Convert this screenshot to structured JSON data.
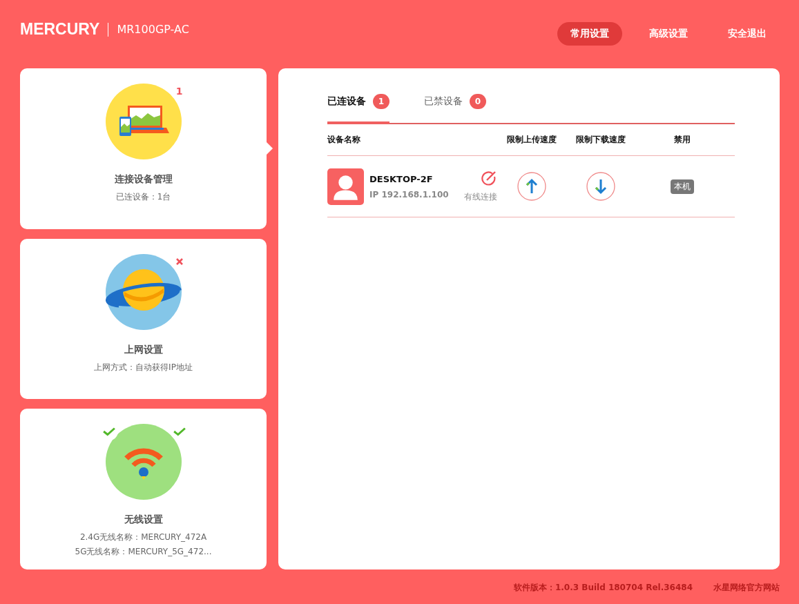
{
  "header": {
    "brand": "MERCURY",
    "model": "MR100GP-AC"
  },
  "nav": [
    {
      "label": "常用设置",
      "selected": true
    },
    {
      "label": "高级设置",
      "selected": false
    },
    {
      "label": "安全退出",
      "selected": false
    }
  ],
  "cards": [
    {
      "kind": "devices",
      "title": "连接设备管理",
      "selected": true,
      "badges": [
        {
          "kind": "count",
          "text": "1"
        }
      ],
      "lines": [
        "已连设备：1台"
      ]
    },
    {
      "kind": "internet",
      "title": "上网设置",
      "selected": false,
      "badges": [
        {
          "kind": "error"
        }
      ],
      "lines": [
        "上网方式：自动获得IP地址"
      ]
    },
    {
      "kind": "wireless",
      "title": "无线设置",
      "selected": false,
      "badges": [
        {
          "kind": "ok"
        },
        {
          "kind": "ok"
        }
      ],
      "lines": [
        "2.4G无线名称：MERCURY_472A",
        "5G无线名称：MERCURY_5G_472..."
      ]
    }
  ],
  "tabs": [
    {
      "label": "已连设备",
      "count": "1",
      "selected": true
    },
    {
      "label": "已禁设备",
      "count": "0",
      "selected": false
    }
  ],
  "table": {
    "columns": [
      "设备名称",
      "限制上传速度",
      "限制下载速度",
      "禁用"
    ],
    "rows": [
      {
        "name": "DESKTOP-2F",
        "ip": "IP 192.168.1.100",
        "connection": "有线连接",
        "tag": "本机"
      }
    ]
  },
  "footer": {
    "version": "软件版本：1.0.3 Build 180704 Rel.36484",
    "link": "水星网络官方网站"
  }
}
